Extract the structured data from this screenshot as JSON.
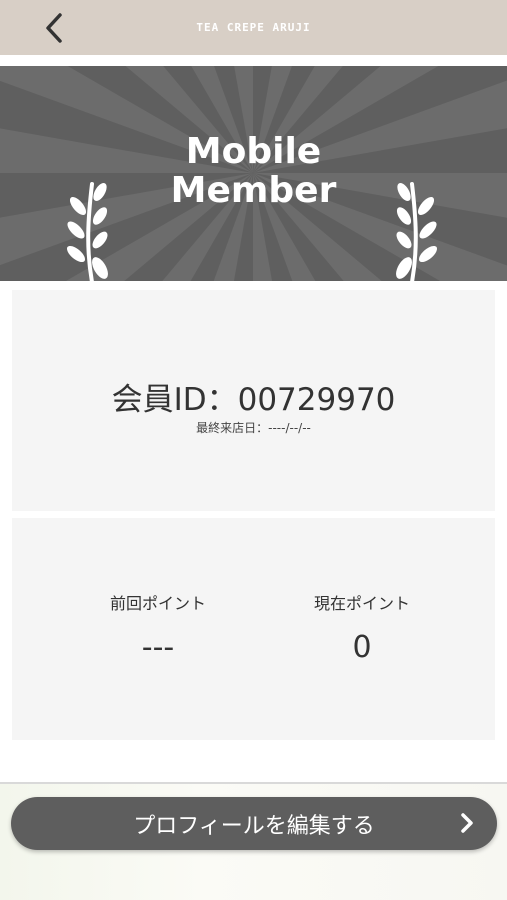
{
  "header": {
    "title": "TEA CREPE ARUJI",
    "back_icon": "chevron-left-icon"
  },
  "hero": {
    "title_line1": "Mobile",
    "title_line2": "Member",
    "decoration": "laurel-icon"
  },
  "member": {
    "id_text": "会員ID：00729970",
    "last_visit": "最終来店日：----/--/--"
  },
  "points": {
    "previous_label": "前回ポイント",
    "previous_value": "---",
    "current_label": "現在ポイント",
    "current_value": "0"
  },
  "actions": {
    "edit_profile_label": "プロフィールを編集する",
    "edit_profile_icon": "chevron-right-icon"
  },
  "colors": {
    "header_bg": "#d8cfc6",
    "hero_bg": "#5f5f5f",
    "card_bg": "#f5f5f5",
    "button_bg": "#5e5e5e"
  }
}
